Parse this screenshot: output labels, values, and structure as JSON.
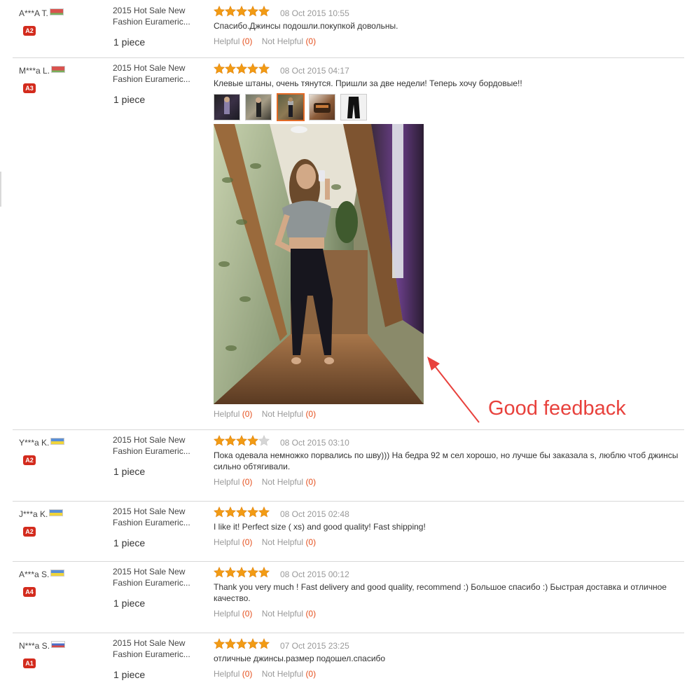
{
  "colors": {
    "accent": "#e5501e",
    "star": "#f29b14",
    "badge": "#d32b1d",
    "annotation": "#e8413c"
  },
  "annotation": {
    "text": "Good feedback"
  },
  "labels": {
    "helpful": "Helpful",
    "not_helpful": "Not Helpful"
  },
  "reviews": [
    {
      "user": "A***A T.",
      "flag": "belarus",
      "level": "A2",
      "product": "2015 Hot Sale New Fashion Eurameric...",
      "qty": "1 piece",
      "stars": 5,
      "date": "08 Oct 2015 10:55",
      "text": "Спасибо.Джинсы подошли.покупкой довольны.",
      "helpful": "(0)",
      "not_helpful": "(0)"
    },
    {
      "user": "M***a L.",
      "flag": "belarus",
      "level": "A3",
      "product": "2015 Hot Sale New Fashion Eurameric...",
      "qty": "1 piece",
      "stars": 5,
      "date": "08 Oct 2015 04:17",
      "text": "Клевые штаны, очень тянутся. Пришли за две недели! Теперь хочу бордовые!!",
      "thumbnails": 5,
      "selected_thumbnail": 3,
      "helpful": "(0)",
      "not_helpful": "(0)"
    },
    {
      "user": "Y***a K.",
      "flag": "ukraine",
      "level": "A2",
      "product": "2015 Hot Sale New Fashion Eurameric...",
      "qty": "1 piece",
      "stars": 4,
      "date": "08 Oct 2015 03:10",
      "text": "Пока одевала немножко порвались по шву))) На бедра 92 м сел хорошо, но лучше бы заказала s, люблю чтоб джинсы сильно обтягивали.",
      "helpful": "(0)",
      "not_helpful": "(0)"
    },
    {
      "user": "J***a K.",
      "flag": "ukraine",
      "level": "A2",
      "product": "2015 Hot Sale New Fashion Eurameric...",
      "qty": "1 piece",
      "stars": 5,
      "date": "08 Oct 2015 02:48",
      "text": "I like it! Perfect size ( xs) and good quality! Fast shipping!",
      "helpful": "(0)",
      "not_helpful": "(0)"
    },
    {
      "user": "A***a S.",
      "flag": "ukraine",
      "level": "A4",
      "product": "2015 Hot Sale New Fashion Eurameric...",
      "qty": "1 piece",
      "stars": 5,
      "date": "08 Oct 2015 00:12",
      "text": "Thank you very much ! Fast delivery and good quality, recommend :) Большое спасибо :) Быстрая доставка и отличное качество.",
      "helpful": "(0)",
      "not_helpful": "(0)"
    },
    {
      "user": "N***a S.",
      "flag": "russia",
      "level": "A1",
      "product": "2015 Hot Sale New Fashion Eurameric...",
      "qty": "1 piece",
      "stars": 5,
      "date": "07 Oct 2015 23:25",
      "text": "отличные джинсы.размер подошел.спасибо",
      "helpful": "(0)",
      "not_helpful": "(0)"
    }
  ]
}
